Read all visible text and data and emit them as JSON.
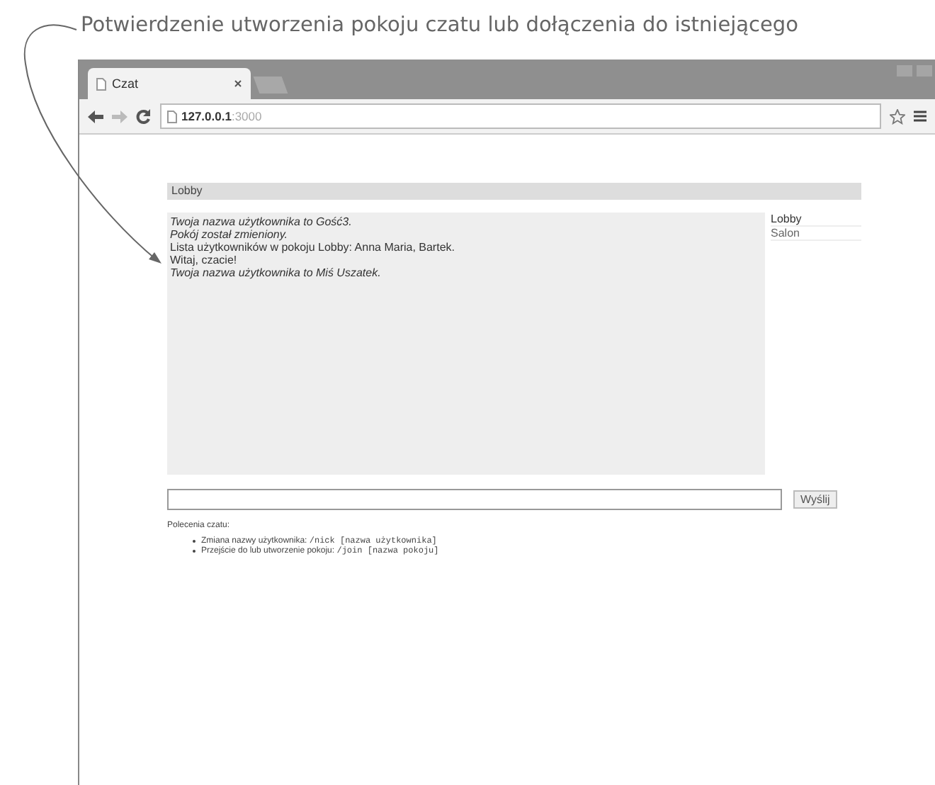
{
  "caption": "Potwierdzenie utworzenia pokoju czatu lub dołączenia do istniejącego",
  "browser": {
    "tab_title": "Czat",
    "url_host": "127.0.0.1",
    "url_port": ":3000"
  },
  "room_title": "Lobby",
  "messages": [
    {
      "kind": "system",
      "text": "Twoja nazwa użytkownika to Gość3."
    },
    {
      "kind": "system",
      "text": "Pokój został zmieniony."
    },
    {
      "kind": "message",
      "text": "Lista użytkowników w pokoju Lobby: Anna Maria, Bartek."
    },
    {
      "kind": "message",
      "text": "Witaj, czacie!"
    },
    {
      "kind": "system",
      "text": "Twoja nazwa użytkownika to Miś Uszatek."
    }
  ],
  "rooms": [
    "Lobby",
    "Salon"
  ],
  "send_button": "Wyślij",
  "help": {
    "title": "Polecenia czatu:",
    "items": [
      {
        "label": "Zmiana nazwy użytkownika:",
        "command": "/nick [nazwa użytkownika]"
      },
      {
        "label": "Przejście do lub utworzenie pokoju:",
        "command": "/join [nazwa pokoju]"
      }
    ]
  }
}
